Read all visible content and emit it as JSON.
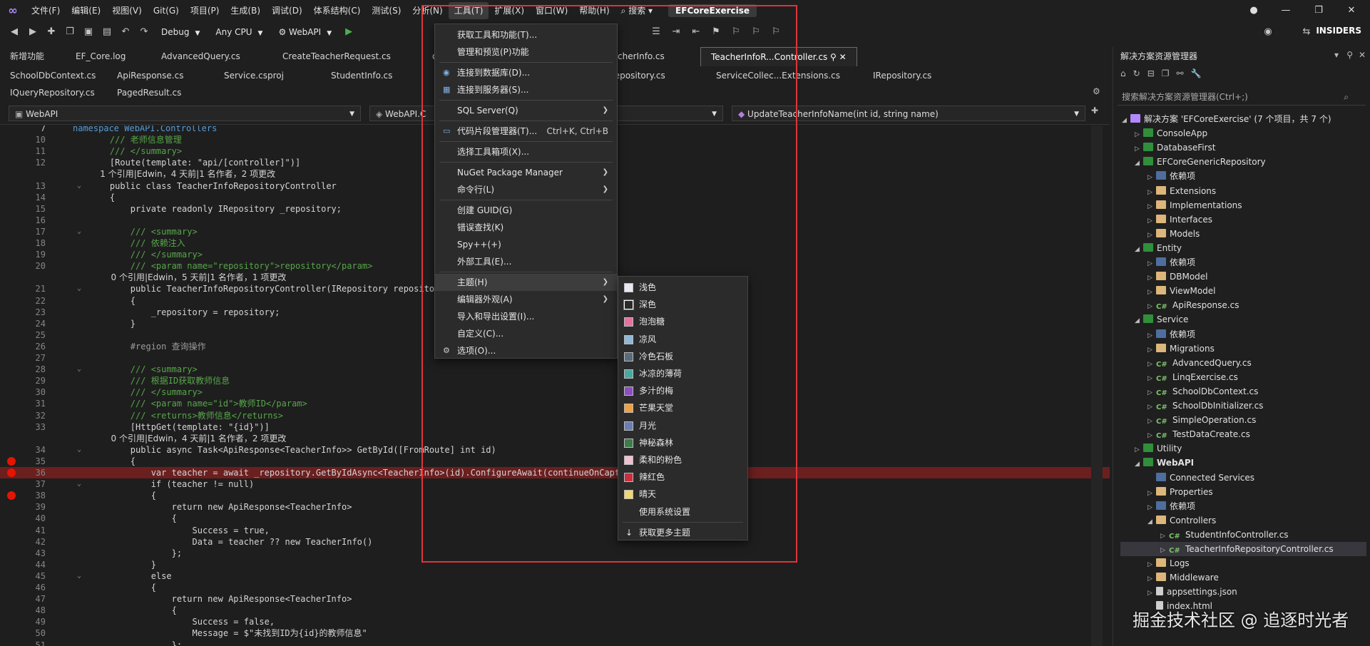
{
  "menu": {
    "items": [
      "文件(F)",
      "编辑(E)",
      "视图(V)",
      "Git(G)",
      "项目(P)",
      "生成(B)",
      "调试(D)",
      "体系结构(C)",
      "测试(S)",
      "分析(N)",
      "工具(T)",
      "扩展(X)",
      "窗口(W)",
      "帮助(H)"
    ],
    "search_label": "搜索",
    "solution_name": "EFCoreExercise"
  },
  "toolbar": {
    "config": "Debug",
    "platform": "Any CPU",
    "startup": "WebAPI",
    "insiders": "INSIDERS"
  },
  "tabs_row1": [
    "新增功能",
    "EF_Core.log",
    "AdvancedQuery.cs",
    "CreateTeacherRequest.cs",
    "ountDto.cs",
    "TeacherInfo.cs",
    "TeacherInfoR...Controller.cs"
  ],
  "tabs_row2": [
    "SchoolDbContext.cs",
    "ApiResponse.cs",
    "Service.csproj",
    "StudentInfo.cs",
    "ller.cs",
    "Repository.cs",
    "ServiceCollec...Extensions.cs",
    "IRepository.cs"
  ],
  "tabs_row3": [
    "IQueryRepository.cs",
    "PagedResult.cs"
  ],
  "navbar": {
    "project": "WebAPI",
    "class": "WebAPI.C",
    "member": "UpdateTeacherInfoName(int id, string name)"
  },
  "code_lines": [
    {
      "n": "7",
      "t": "namespace WebAPI.Controllers"
    },
    {
      "n": "10",
      "t": "    /// 老师信息管理"
    },
    {
      "n": "11",
      "t": "    /// </summary>"
    },
    {
      "n": "12",
      "t": "    [Route(template: \"api/[controller]\")]"
    },
    {
      "n": "",
      "t": "    1 个引用|Edwin，4 天前|1 名作者，2 项更改"
    },
    {
      "n": "13",
      "t": "    public class TeacherInfoRepositoryController"
    },
    {
      "n": "14",
      "t": "    {"
    },
    {
      "n": "15",
      "t": "        private readonly IRepository _repository;"
    },
    {
      "n": "16",
      "t": ""
    },
    {
      "n": "17",
      "t": "        /// <summary>"
    },
    {
      "n": "18",
      "t": "        /// 依赖注入"
    },
    {
      "n": "19",
      "t": "        /// </summary>"
    },
    {
      "n": "20",
      "t": "        /// <param name=\"repository\">repository</param>"
    },
    {
      "n": "",
      "t": "        0 个引用|Edwin，5 天前|1 名作者，1 项更改"
    },
    {
      "n": "21",
      "t": "        public TeacherInfoRepositoryController(IRepository repository"
    },
    {
      "n": "22",
      "t": "        {"
    },
    {
      "n": "23",
      "t": "            _repository = repository;"
    },
    {
      "n": "24",
      "t": "        }"
    },
    {
      "n": "25",
      "t": ""
    },
    {
      "n": "26",
      "t": "        #region 查询操作"
    },
    {
      "n": "27",
      "t": ""
    },
    {
      "n": "28",
      "t": "        /// <summary>"
    },
    {
      "n": "29",
      "t": "        /// 根据ID获取教师信息"
    },
    {
      "n": "30",
      "t": "        /// </summary>"
    },
    {
      "n": "31",
      "t": "        /// <param name=\"id\">教师ID</param>"
    },
    {
      "n": "32",
      "t": "        /// <returns>教师信息</returns>"
    },
    {
      "n": "33",
      "t": "        [HttpGet(template: \"{id}\")]"
    },
    {
      "n": "",
      "t": "        0 个引用|Edwin，4 天前|1 名作者，2 项更改"
    },
    {
      "n": "34",
      "t": "        public async Task<ApiResponse<TeacherInfo>> GetById([FromRoute] int id)"
    },
    {
      "n": "35",
      "t": "        {"
    },
    {
      "n": "36",
      "t": "            var teacher = await _repository.GetByIdAsync<TeacherInfo>(id).ConfigureAwait(continueOnCapturedCont"
    },
    {
      "n": "37",
      "t": "            if (teacher != null)"
    },
    {
      "n": "38",
      "t": "            {"
    },
    {
      "n": "39",
      "t": "                return new ApiResponse<TeacherInfo>"
    },
    {
      "n": "40",
      "t": "                {"
    },
    {
      "n": "41",
      "t": "                    Success = true,"
    },
    {
      "n": "42",
      "t": "                    Data = teacher ?? new TeacherInfo()"
    },
    {
      "n": "43",
      "t": "                };"
    },
    {
      "n": "44",
      "t": "            }"
    },
    {
      "n": "45",
      "t": "            else"
    },
    {
      "n": "46",
      "t": "            {"
    },
    {
      "n": "47",
      "t": "                return new ApiResponse<TeacherInfo>"
    },
    {
      "n": "48",
      "t": "                {"
    },
    {
      "n": "49",
      "t": "                    Success = false,"
    },
    {
      "n": "50",
      "t": "                    Message = $\"未找到ID为{id}的教师信息\""
    },
    {
      "n": "51",
      "t": "                };"
    }
  ],
  "tools_menu": [
    {
      "label": "获取工具和功能(T)...",
      "shortcut": "",
      "sub": false
    },
    {
      "label": "管理和预览(P)功能",
      "shortcut": "",
      "sub": false
    },
    {
      "label": "连接到数据库(D)...",
      "shortcut": "",
      "sub": false
    },
    {
      "label": "连接到服务器(S)...",
      "shortcut": "",
      "sub": false
    },
    {
      "label": "SQL Server(Q)",
      "shortcut": "",
      "sub": true
    },
    {
      "label": "代码片段管理器(T)...",
      "shortcut": "Ctrl+K, Ctrl+B",
      "sub": false
    },
    {
      "label": "选择工具箱项(X)...",
      "shortcut": "",
      "sub": false
    },
    {
      "label": "NuGet Package Manager",
      "shortcut": "",
      "sub": true
    },
    {
      "label": "命令行(L)",
      "shortcut": "",
      "sub": true
    },
    {
      "label": "创建 GUID(G)",
      "shortcut": "",
      "sub": false
    },
    {
      "label": "错误查找(K)",
      "shortcut": "",
      "sub": false
    },
    {
      "label": "Spy++(+)",
      "shortcut": "",
      "sub": false
    },
    {
      "label": "外部工具(E)...",
      "shortcut": "",
      "sub": false
    },
    {
      "label": "主题(H)",
      "shortcut": "",
      "sub": true
    },
    {
      "label": "编辑器外观(A)",
      "shortcut": "",
      "sub": true
    },
    {
      "label": "导入和导出设置(I)...",
      "shortcut": "",
      "sub": false
    },
    {
      "label": "自定义(C)...",
      "shortcut": "",
      "sub": false
    },
    {
      "label": "选项(O)...",
      "shortcut": "",
      "sub": false
    }
  ],
  "theme_menu": [
    {
      "label": "浅色",
      "color": "#e8e8f0"
    },
    {
      "label": "深色",
      "color": "#2b2b2b"
    },
    {
      "label": "泡泡糖",
      "color": "#e86fa0"
    },
    {
      "label": "凉风",
      "color": "#8fb8d8"
    },
    {
      "label": "冷色石板",
      "color": "#5a6b7c"
    },
    {
      "label": "冰凉的薄荷",
      "color": "#4aa8a0"
    },
    {
      "label": "多汁的梅",
      "color": "#8a4fc0"
    },
    {
      "label": "芒果天堂",
      "color": "#f0a040"
    },
    {
      "label": "月光",
      "color": "#6a7fb0"
    },
    {
      "label": "神秘森林",
      "color": "#3f7a4a"
    },
    {
      "label": "柔和的粉色",
      "color": "#f0c0d0"
    },
    {
      "label": "辣红色",
      "color": "#c83040"
    },
    {
      "label": "晴天",
      "color": "#f0d870"
    },
    {
      "label": "使用系统设置",
      "color": ""
    },
    {
      "label": "获取更多主题",
      "color": ""
    }
  ],
  "solution_explorer": {
    "title": "解决方案资源管理器",
    "search_placeholder": "搜索解决方案资源管理器(Ctrl+;)",
    "items": [
      {
        "label": "解决方案 'EFCoreExercise' (7 个项目，共 7 个)",
        "depth": 0,
        "icon": "sol",
        "arrow": "◢"
      },
      {
        "label": "ConsoleApp",
        "depth": 1,
        "icon": "proj",
        "arrow": "▷"
      },
      {
        "label": "DatabaseFirst",
        "depth": 1,
        "icon": "proj",
        "arrow": "▷"
      },
      {
        "label": "EFCoreGenericRepository",
        "depth": 1,
        "icon": "proj",
        "arrow": "◢"
      },
      {
        "label": "依赖项",
        "depth": 2,
        "icon": "dep",
        "arrow": "▷"
      },
      {
        "label": "Extensions",
        "depth": 2,
        "icon": "folder",
        "arrow": "▷"
      },
      {
        "label": "Implementations",
        "depth": 2,
        "icon": "folder",
        "arrow": "▷"
      },
      {
        "label": "Interfaces",
        "depth": 2,
        "icon": "folder",
        "arrow": "▷"
      },
      {
        "label": "Models",
        "depth": 2,
        "icon": "folder",
        "arrow": "▷"
      },
      {
        "label": "Entity",
        "depth": 1,
        "icon": "proj",
        "arrow": "◢"
      },
      {
        "label": "依赖项",
        "depth": 2,
        "icon": "dep",
        "arrow": "▷"
      },
      {
        "label": "DBModel",
        "depth": 2,
        "icon": "folder",
        "arrow": "▷"
      },
      {
        "label": "ViewModel",
        "depth": 2,
        "icon": "folder",
        "arrow": "▷"
      },
      {
        "label": "ApiResponse.cs",
        "depth": 2,
        "icon": "cs",
        "arrow": "▷"
      },
      {
        "label": "Service",
        "depth": 1,
        "icon": "proj",
        "arrow": "◢"
      },
      {
        "label": "依赖项",
        "depth": 2,
        "icon": "dep",
        "arrow": "▷"
      },
      {
        "label": "Migrations",
        "depth": 2,
        "icon": "folder",
        "arrow": "▷"
      },
      {
        "label": "AdvancedQuery.cs",
        "depth": 2,
        "icon": "cs",
        "arrow": "▷"
      },
      {
        "label": "LinqExercise.cs",
        "depth": 2,
        "icon": "cs",
        "arrow": "▷"
      },
      {
        "label": "SchoolDbContext.cs",
        "depth": 2,
        "icon": "cs",
        "arrow": "▷"
      },
      {
        "label": "SchoolDbInitializer.cs",
        "depth": 2,
        "icon": "cs",
        "arrow": "▷"
      },
      {
        "label": "SimpleOperation.cs",
        "depth": 2,
        "icon": "cs",
        "arrow": "▷"
      },
      {
        "label": "TestDataCreate.cs",
        "depth": 2,
        "icon": "cs",
        "arrow": "▷"
      },
      {
        "label": "Utility",
        "depth": 1,
        "icon": "proj",
        "arrow": "▷"
      },
      {
        "label": "WebAPI",
        "depth": 1,
        "icon": "proj",
        "arrow": "◢"
      },
      {
        "label": "Connected Services",
        "depth": 2,
        "icon": "dep",
        "arrow": ""
      },
      {
        "label": "Properties",
        "depth": 2,
        "icon": "folder",
        "arrow": "▷"
      },
      {
        "label": "依赖项",
        "depth": 2,
        "icon": "dep",
        "arrow": "▷"
      },
      {
        "label": "Controllers",
        "depth": 2,
        "icon": "folder",
        "arrow": "◢"
      },
      {
        "label": "StudentInfoController.cs",
        "depth": 3,
        "icon": "cs",
        "arrow": "▷"
      },
      {
        "label": "TeacherInfoRepositoryController.cs",
        "depth": 3,
        "icon": "cs",
        "arrow": "▷"
      },
      {
        "label": "Logs",
        "depth": 2,
        "icon": "folder",
        "arrow": "▷"
      },
      {
        "label": "Middleware",
        "depth": 2,
        "icon": "folder",
        "arrow": "▷"
      },
      {
        "label": "appsettings.json",
        "depth": 2,
        "icon": "file",
        "arrow": "▷"
      },
      {
        "label": "index.html",
        "depth": 2,
        "icon": "file",
        "arrow": ""
      }
    ]
  },
  "watermark": "掘金技术社区 @ 追逐时光者",
  "colors": {
    "accent": "#b388ff",
    "highlight_box": "#e0343a",
    "breakpoint": "#e51400"
  }
}
